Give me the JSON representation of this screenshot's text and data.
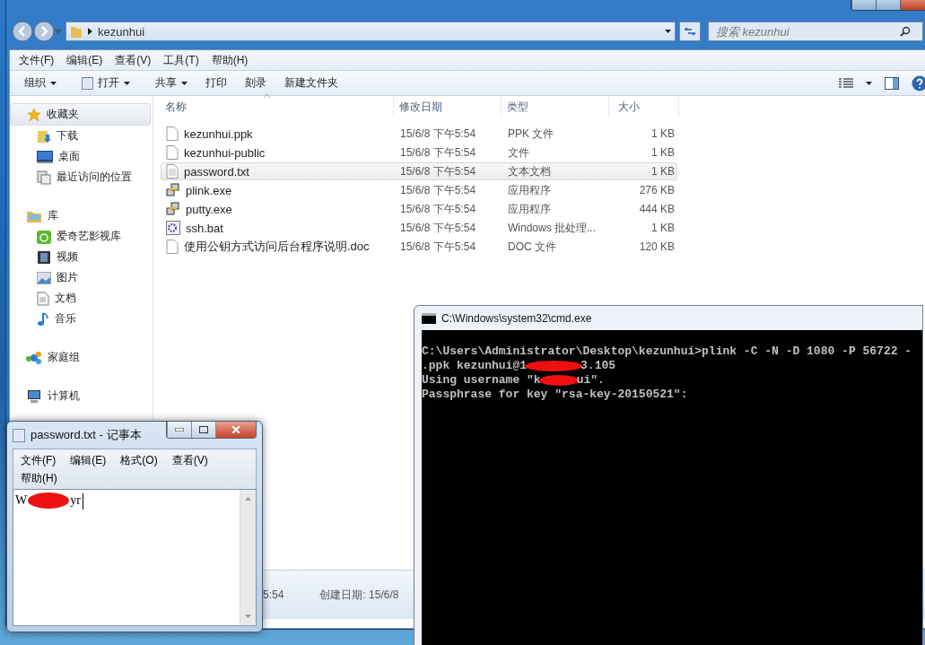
{
  "explorer": {
    "address": {
      "path": "kezunhui"
    },
    "search": {
      "placeholder": "搜索 kezunhui"
    },
    "menu": [
      "文件(F)",
      "编辑(E)",
      "查看(V)",
      "工具(T)",
      "帮助(H)"
    ],
    "toolbar": [
      {
        "label": "组织",
        "kind": "dropdown"
      },
      {
        "label": "打开",
        "kind": "open"
      },
      {
        "label": "共享",
        "kind": "dropdown"
      },
      {
        "label": "打印",
        "kind": "plain"
      },
      {
        "label": "刻录",
        "kind": "plain"
      },
      {
        "label": "新建文件夹",
        "kind": "plain"
      }
    ],
    "sidebar": [
      {
        "label": "收藏夹",
        "kind": "star",
        "selected": true,
        "children": [
          {
            "label": "下载",
            "kind": "download"
          },
          {
            "label": "桌面",
            "kind": "desktop"
          },
          {
            "label": "最近访问的位置",
            "kind": "recent"
          }
        ]
      },
      {
        "label": "库",
        "kind": "library",
        "selected": false,
        "children": [
          {
            "label": "爱奇艺影视库",
            "kind": "media"
          },
          {
            "label": "视频",
            "kind": "video"
          },
          {
            "label": "图片",
            "kind": "image"
          },
          {
            "label": "文档",
            "kind": "doc"
          },
          {
            "label": "音乐",
            "kind": "music"
          }
        ]
      },
      {
        "label": "家庭组",
        "kind": "homegroup",
        "selected": false
      },
      {
        "label": "计算机",
        "kind": "computer",
        "selected": false
      }
    ],
    "columns": [
      "名称",
      "修改日期",
      "类型",
      "大小"
    ],
    "files": [
      {
        "name": "kezunhui.ppk",
        "kind": "file",
        "modified": "15/6/8 下午5:54",
        "type": "PPK 文件",
        "size": "1 KB",
        "selected": false
      },
      {
        "name": "kezunhui-public",
        "kind": "file",
        "modified": "15/6/8 下午5:54",
        "type": "文件",
        "size": "1 KB",
        "selected": false
      },
      {
        "name": "password.txt",
        "kind": "text",
        "modified": "15/6/8 下午5:54",
        "type": "文本文档",
        "size": "1 KB",
        "selected": true
      },
      {
        "name": "plink.exe",
        "kind": "app",
        "modified": "15/6/8 下午5:54",
        "type": "应用程序",
        "size": "276 KB",
        "selected": false
      },
      {
        "name": "putty.exe",
        "kind": "app",
        "modified": "15/6/8 下午5:54",
        "type": "应用程序",
        "size": "444 KB",
        "selected": false
      },
      {
        "name": "ssh.bat",
        "kind": "batch",
        "modified": "15/6/8 下午5:54",
        "type": "Windows 批处理...",
        "size": "1 KB",
        "selected": false
      },
      {
        "name": "使用公钥方式访问后台程序说明.doc",
        "kind": "file",
        "modified": "15/6/8 下午5:54",
        "type": "DOC 文件",
        "size": "120 KB",
        "selected": false
      }
    ],
    "details": {
      "modified": "5:54",
      "created": "创建日期: 15/6/8"
    }
  },
  "cmd": {
    "title": "C:\\Windows\\system32\\cmd.exe",
    "lines": [
      {
        "parts": [
          "C:\\Users\\Administrator\\Desktop\\kezunhui>plink -C -N -D 1080 -P 56722 -"
        ]
      },
      {
        "parts": [
          ".ppk kezunhui@1",
          "3.105"
        ]
      },
      {
        "parts": [
          "Using username \"k",
          "ui\"."
        ]
      },
      {
        "parts": [
          "Passphrase for key \"rsa-key-20150521\":"
        ]
      }
    ]
  },
  "notepad": {
    "title": "password.txt - 记事本",
    "menu": [
      "文件(F)",
      "编辑(E)",
      "格式(O)",
      "查看(V)",
      "帮助(H)"
    ],
    "content": [
      "W",
      "yr"
    ]
  }
}
